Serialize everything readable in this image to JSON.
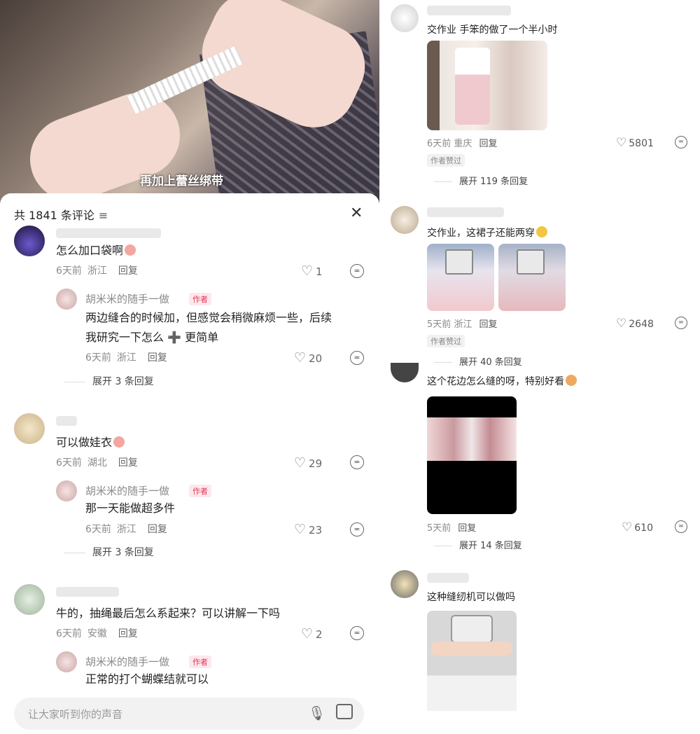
{
  "left": {
    "video": {
      "subtitle": "再加上蕾丝绑带"
    },
    "comments_header": {
      "count_text": "共 1841 条评论",
      "sort_glyph": "≡",
      "close_glyph": "✕"
    },
    "comments": [
      {
        "text": "怎么加口袋啊",
        "time": "6天前",
        "location": "浙江",
        "reply": "回复",
        "likes": "1",
        "author_reply": {
          "name": "胡米米的随手一做",
          "badge": "作者",
          "text_line1": "两边缝合的时候加，但感觉会稍微麻烦一些，后续",
          "text_line2": "我研究一下怎么 ➕ 更简单",
          "time": "6天前",
          "location": "浙江",
          "reply": "回复",
          "likes": "20"
        },
        "expand": "展开 3 条回复"
      },
      {
        "text": "可以做娃衣",
        "time": "6天前",
        "location": "湖北",
        "reply": "回复",
        "likes": "29",
        "author_reply": {
          "name": "胡米米的随手一做",
          "badge": "作者",
          "text_line1": "那一天能做超多件",
          "time": "6天前",
          "location": "浙江",
          "reply": "回复",
          "likes": "23"
        },
        "expand": "展开 3 条回复"
      },
      {
        "text": "牛的，抽绳最后怎么系起来？可以讲解一下吗",
        "time": "6天前",
        "location": "安徽",
        "reply": "回复",
        "likes": "2",
        "author_reply": {
          "name": "胡米米的随手一做",
          "badge": "作者",
          "text_line1": "正常的打个蝴蝶结就可以"
        }
      }
    ],
    "input": {
      "placeholder": "让大家听到你的声音"
    }
  },
  "right": {
    "comments": [
      {
        "text": "交作业 手笨的做了一个半小时",
        "time": "6天前",
        "location": "重庆",
        "reply": "回复",
        "likes": "5801",
        "badge": "作者赞过",
        "expand": "展开 119 条回复"
      },
      {
        "text": "交作业，这裙子还能两穿",
        "time": "5天前",
        "location": "浙江",
        "reply": "回复",
        "likes": "2648",
        "badge": "作者赞过",
        "expand": "展开 40 条回复"
      },
      {
        "text": "这个花边怎么缝的呀，特别好看",
        "time": "5天前",
        "reply": "回复",
        "likes": "610",
        "expand": "展开 14 条回复"
      },
      {
        "text": "这种缝纫机可以做吗"
      }
    ]
  },
  "colors": {
    "author_badge": "#e2365a",
    "muted_text": "#8a8a8a"
  }
}
